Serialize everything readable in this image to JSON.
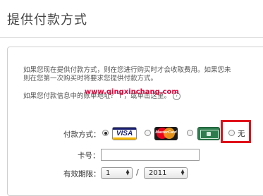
{
  "page": {
    "title": "提供付款方式"
  },
  "intro": {
    "line1": "如果您现在提供付款方式，则在您进行购买时才会收取费用。如果您未",
    "line2": "则在您第一次购买时将要求您提供付款方式。"
  },
  "help": {
    "text": "如果您付款信息中的账单地址？Ｔ，或单击这里。"
  },
  "watermark": {
    "text": "www.qingxinchang.com"
  },
  "payment": {
    "label": "付款方式：",
    "options": [
      {
        "name": "VISA",
        "checked": true
      },
      {
        "name": "MasterCard",
        "checked": false
      },
      {
        "name": "AmericanExpress",
        "checked": false
      },
      {
        "name": "无",
        "checked": false
      }
    ],
    "visa_text": "VISA",
    "mc_text": "MasterCard",
    "none_label": "无"
  },
  "card_number": {
    "label": "卡号：",
    "value": ""
  },
  "expiry": {
    "label": "有效期限：",
    "month": "1",
    "slash": "/",
    "year": "2011"
  },
  "colors": {
    "highlight": "#e0101a",
    "watermark": "#e0003a"
  },
  "icons": {
    "arrow": "circle-arrow-icon",
    "select_chevron": "chevron-updown-icon"
  }
}
